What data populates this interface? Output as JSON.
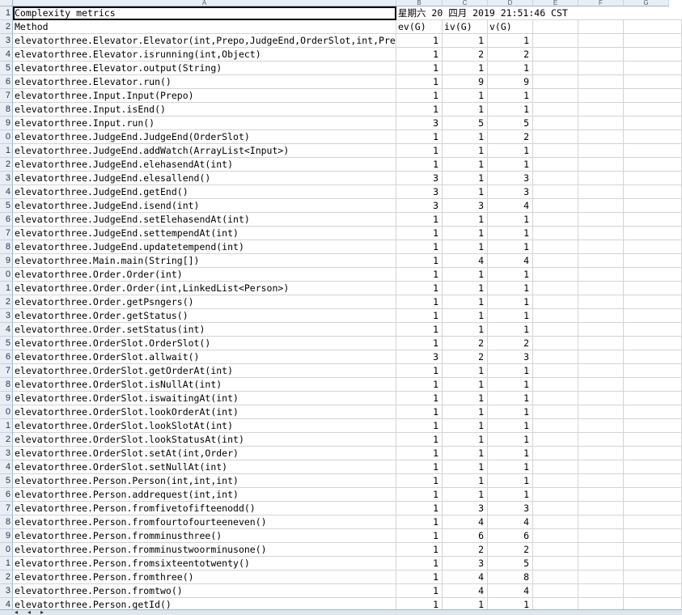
{
  "columns": [
    "A",
    "B",
    "C",
    "D",
    "E",
    "F",
    "G"
  ],
  "header_row": {
    "title": "Complexity metrics",
    "date_text": "星期六  20 四月 2019 21:51:46 CST"
  },
  "labels_row": {
    "method": "Method",
    "ev": "ev(G)",
    "iv": "iv(G)",
    "v": "v(G)"
  },
  "rows": [
    {
      "n": "3",
      "m": "elevatorthree.Elevator.Elevator(int,Prepo,JudgeEnd,OrderSlot,int,Pre",
      "ev": "1",
      "iv": "1",
      "v": "1"
    },
    {
      "n": "4",
      "m": "elevatorthree.Elevator.isrunning(int,Object)",
      "ev": "1",
      "iv": "2",
      "v": "2"
    },
    {
      "n": "5",
      "m": "elevatorthree.Elevator.output(String)",
      "ev": "1",
      "iv": "1",
      "v": "1"
    },
    {
      "n": "6",
      "m": "elevatorthree.Elevator.run()",
      "ev": "1",
      "iv": "9",
      "v": "9"
    },
    {
      "n": "7",
      "m": "elevatorthree.Input.Input(Prepo)",
      "ev": "1",
      "iv": "1",
      "v": "1"
    },
    {
      "n": "8",
      "m": "elevatorthree.Input.isEnd()",
      "ev": "1",
      "iv": "1",
      "v": "1"
    },
    {
      "n": "9",
      "m": "elevatorthree.Input.run()",
      "ev": "3",
      "iv": "5",
      "v": "5"
    },
    {
      "n": "0",
      "m": "elevatorthree.JudgeEnd.JudgeEnd(OrderSlot)",
      "ev": "1",
      "iv": "1",
      "v": "2"
    },
    {
      "n": "1",
      "m": "elevatorthree.JudgeEnd.addWatch(ArrayList<Input>)",
      "ev": "1",
      "iv": "1",
      "v": "1"
    },
    {
      "n": "2",
      "m": "elevatorthree.JudgeEnd.elehasendAt(int)",
      "ev": "1",
      "iv": "1",
      "v": "1"
    },
    {
      "n": "3",
      "m": "elevatorthree.JudgeEnd.elesallend()",
      "ev": "3",
      "iv": "1",
      "v": "3"
    },
    {
      "n": "4",
      "m": "elevatorthree.JudgeEnd.getEnd()",
      "ev": "3",
      "iv": "1",
      "v": "3"
    },
    {
      "n": "5",
      "m": "elevatorthree.JudgeEnd.isend(int)",
      "ev": "3",
      "iv": "3",
      "v": "4"
    },
    {
      "n": "6",
      "m": "elevatorthree.JudgeEnd.setElehasendAt(int)",
      "ev": "1",
      "iv": "1",
      "v": "1"
    },
    {
      "n": "7",
      "m": "elevatorthree.JudgeEnd.settempendAt(int)",
      "ev": "1",
      "iv": "1",
      "v": "1"
    },
    {
      "n": "8",
      "m": "elevatorthree.JudgeEnd.updatetempend(int)",
      "ev": "1",
      "iv": "1",
      "v": "1"
    },
    {
      "n": "9",
      "m": "elevatorthree.Main.main(String[])",
      "ev": "1",
      "iv": "4",
      "v": "4"
    },
    {
      "n": "0",
      "m": "elevatorthree.Order.Order(int)",
      "ev": "1",
      "iv": "1",
      "v": "1"
    },
    {
      "n": "1",
      "m": "elevatorthree.Order.Order(int,LinkedList<Person>)",
      "ev": "1",
      "iv": "1",
      "v": "1"
    },
    {
      "n": "2",
      "m": "elevatorthree.Order.getPsngers()",
      "ev": "1",
      "iv": "1",
      "v": "1"
    },
    {
      "n": "3",
      "m": "elevatorthree.Order.getStatus()",
      "ev": "1",
      "iv": "1",
      "v": "1"
    },
    {
      "n": "4",
      "m": "elevatorthree.Order.setStatus(int)",
      "ev": "1",
      "iv": "1",
      "v": "1"
    },
    {
      "n": "5",
      "m": "elevatorthree.OrderSlot.OrderSlot()",
      "ev": "1",
      "iv": "2",
      "v": "2"
    },
    {
      "n": "6",
      "m": "elevatorthree.OrderSlot.allwait()",
      "ev": "3",
      "iv": "2",
      "v": "3"
    },
    {
      "n": "7",
      "m": "elevatorthree.OrderSlot.getOrderAt(int)",
      "ev": "1",
      "iv": "1",
      "v": "1"
    },
    {
      "n": "8",
      "m": "elevatorthree.OrderSlot.isNullAt(int)",
      "ev": "1",
      "iv": "1",
      "v": "1"
    },
    {
      "n": "9",
      "m": "elevatorthree.OrderSlot.iswaitingAt(int)",
      "ev": "1",
      "iv": "1",
      "v": "1"
    },
    {
      "n": "0",
      "m": "elevatorthree.OrderSlot.lookOrderAt(int)",
      "ev": "1",
      "iv": "1",
      "v": "1"
    },
    {
      "n": "1",
      "m": "elevatorthree.OrderSlot.lookSlotAt(int)",
      "ev": "1",
      "iv": "1",
      "v": "1"
    },
    {
      "n": "2",
      "m": "elevatorthree.OrderSlot.lookStatusAt(int)",
      "ev": "1",
      "iv": "1",
      "v": "1"
    },
    {
      "n": "3",
      "m": "elevatorthree.OrderSlot.setAt(int,Order)",
      "ev": "1",
      "iv": "1",
      "v": "1"
    },
    {
      "n": "4",
      "m": "elevatorthree.OrderSlot.setNullAt(int)",
      "ev": "1",
      "iv": "1",
      "v": "1"
    },
    {
      "n": "5",
      "m": "elevatorthree.Person.Person(int,int,int)",
      "ev": "1",
      "iv": "1",
      "v": "1"
    },
    {
      "n": "6",
      "m": "elevatorthree.Person.addrequest(int,int)",
      "ev": "1",
      "iv": "1",
      "v": "1"
    },
    {
      "n": "7",
      "m": "elevatorthree.Person.fromfivetofifteenodd()",
      "ev": "1",
      "iv": "3",
      "v": "3"
    },
    {
      "n": "8",
      "m": "elevatorthree.Person.fromfourtofourteeneven()",
      "ev": "1",
      "iv": "4",
      "v": "4"
    },
    {
      "n": "9",
      "m": "elevatorthree.Person.fromminusthree()",
      "ev": "1",
      "iv": "6",
      "v": "6"
    },
    {
      "n": "0",
      "m": "elevatorthree.Person.fromminustwoorminusone()",
      "ev": "1",
      "iv": "2",
      "v": "2"
    },
    {
      "n": "1",
      "m": "elevatorthree.Person.fromsixteentotwenty()",
      "ev": "1",
      "iv": "3",
      "v": "5"
    },
    {
      "n": "2",
      "m": "elevatorthree.Person.fromthree()",
      "ev": "1",
      "iv": "4",
      "v": "8"
    },
    {
      "n": "3",
      "m": "elevatorthree.Person.fromtwo()",
      "ev": "1",
      "iv": "4",
      "v": "4"
    },
    {
      "n": "4",
      "m": "elevatorthree.Person.getId()",
      "ev": "1",
      "iv": "1",
      "v": "1"
    }
  ],
  "colors": {
    "header_bg": "#e9eef5",
    "grid": "#d4d4d4",
    "header_border": "#9eb6ce"
  }
}
